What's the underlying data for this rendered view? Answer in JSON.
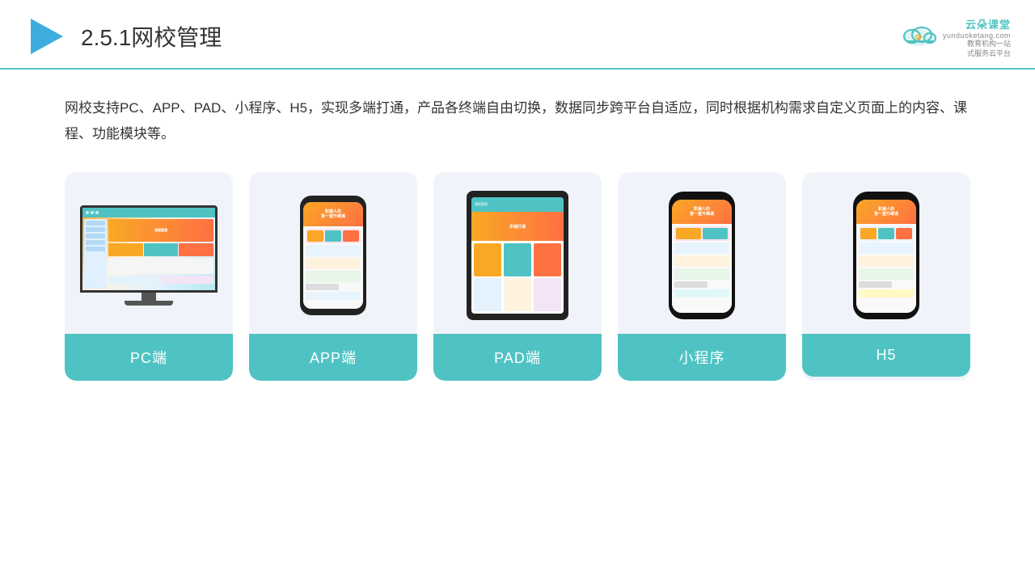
{
  "header": {
    "title": "2.5.1网校管理",
    "logo_main": "云朵课堂",
    "logo_domain": "yunduoketang.com",
    "logo_slogan_line1": "教育机构一站",
    "logo_slogan_line2": "式服务云平台"
  },
  "body": {
    "description": "网校支持PC、APP、PAD、小程序、H5，实现多端打通，产品各终端自由切换，数据同步跨平台自适应，同时根据机构需求自定义页面上的内容、课程、功能模块等。"
  },
  "cards": [
    {
      "id": "pc",
      "label": "PC端"
    },
    {
      "id": "app",
      "label": "APP端"
    },
    {
      "id": "pad",
      "label": "PAD端"
    },
    {
      "id": "miniprogram",
      "label": "小程序"
    },
    {
      "id": "h5",
      "label": "H5"
    }
  ]
}
